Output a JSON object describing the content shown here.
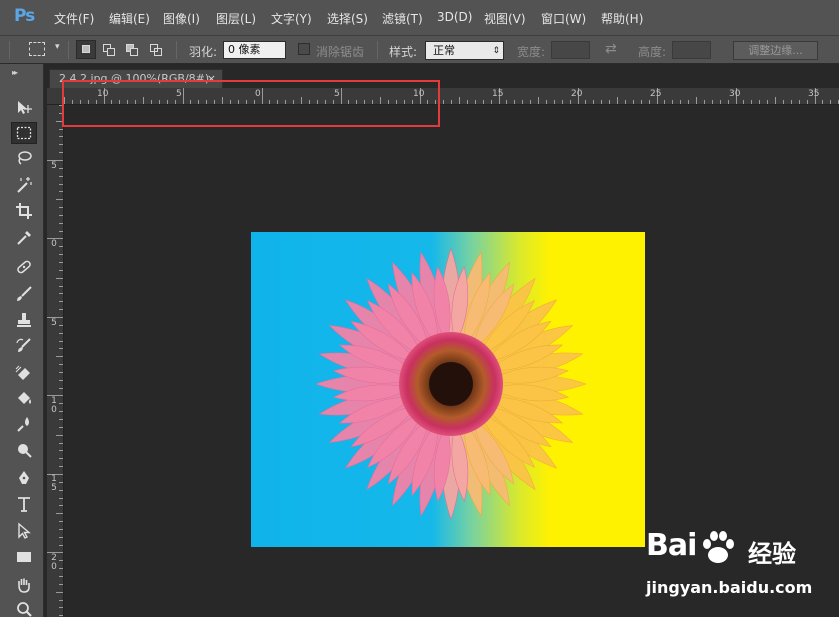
{
  "app": {
    "logo": "Ps"
  },
  "menu": [
    {
      "label": "文件(F)"
    },
    {
      "label": "编辑(E)"
    },
    {
      "label": "图像(I)"
    },
    {
      "label": "图层(L)"
    },
    {
      "label": "文字(Y)"
    },
    {
      "label": "选择(S)"
    },
    {
      "label": "滤镜(T)"
    },
    {
      "label": "3D(D)"
    },
    {
      "label": "视图(V)"
    },
    {
      "label": "窗口(W)"
    },
    {
      "label": "帮助(H)"
    }
  ],
  "options": {
    "feather_label": "羽化:",
    "feather_value": "0 像素",
    "antialias_label": "消除锯齿",
    "style_label": "样式:",
    "style_value": "正常",
    "width_label": "宽度:",
    "height_label": "高度:",
    "refine_edge_label": "调整边缘..."
  },
  "tools": [
    {
      "name": "move-tool",
      "icon": "move-icon"
    },
    {
      "name": "rect-marquee-tool",
      "icon": "rect-marquee-icon",
      "active": true
    },
    {
      "name": "lasso-tool",
      "icon": "lasso-icon"
    },
    {
      "name": "magic-wand-tool",
      "icon": "magic-wand-icon"
    },
    {
      "name": "crop-tool",
      "icon": "crop-icon"
    },
    {
      "name": "eyedropper-tool",
      "icon": "eyedropper-icon"
    },
    {
      "name": "healing-brush-tool",
      "icon": "bandage-icon"
    },
    {
      "name": "brush-tool",
      "icon": "brush-icon"
    },
    {
      "name": "clone-stamp-tool",
      "icon": "stamp-icon"
    },
    {
      "name": "history-brush-tool",
      "icon": "history-brush-icon"
    },
    {
      "name": "eraser-tool",
      "icon": "eraser-icon"
    },
    {
      "name": "paint-bucket-tool",
      "icon": "paint-bucket-icon"
    },
    {
      "name": "blur-tool",
      "icon": "drop-icon"
    },
    {
      "name": "dodge-tool",
      "icon": "dodge-icon"
    },
    {
      "name": "pen-tool",
      "icon": "pen-icon"
    },
    {
      "name": "type-tool",
      "icon": "type-icon"
    },
    {
      "name": "path-selection-tool",
      "icon": "arrow-cursor-icon"
    },
    {
      "name": "rectangle-tool",
      "icon": "rectangle-icon"
    },
    {
      "name": "hand-tool",
      "icon": "hand-icon"
    },
    {
      "name": "zoom-tool",
      "icon": "zoom-icon"
    }
  ],
  "document": {
    "tab_title": "2.4.2.jpg @ 100%(RGB/8#)",
    "close_glyph": "×"
  },
  "ruler_h_labels": [
    "10",
    "5",
    "0",
    "5",
    "10",
    "15",
    "20",
    "25",
    "30",
    "35"
  ],
  "ruler_v_labels": [
    "5",
    "0",
    "5",
    "1 0",
    "1 5",
    "2 0"
  ],
  "watermark": {
    "brand": "Bai",
    "product": "经验",
    "url": "jingyan.baidu.com"
  },
  "colors": {
    "ui_bg": "#535353",
    "canvas_blue": "#16b8ea",
    "canvas_yellow": "#fff200",
    "highlight_red": "#e23b3b"
  }
}
